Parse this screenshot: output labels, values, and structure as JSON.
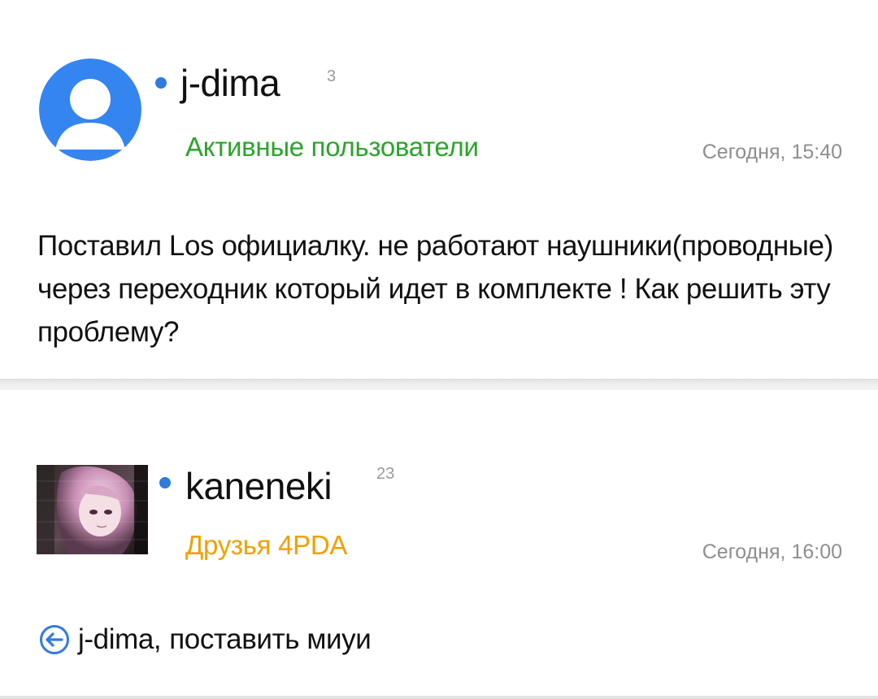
{
  "posts": [
    {
      "author": "j-dima",
      "reputation": "3",
      "group": "Активные пользователи",
      "group_color": "#2aa52a",
      "timestamp": "Сегодня, 15:40",
      "text": "Поставил Los официалку. не работают наушники(проводные) через переходник который идет в комплекте ! Как решить эту проблему?",
      "online": true,
      "avatar": "default-user-icon"
    },
    {
      "author": "kaneneki",
      "reputation": "23",
      "group": "Друзья 4PDA",
      "group_color": "#f0a000",
      "timestamp": "Сегодня, 16:00",
      "reply_to": "j-dima,",
      "text": "поставить миуи",
      "online": true,
      "avatar": "anime-girl-photo"
    }
  ],
  "colors": {
    "online_dot": "#2f7be0",
    "avatar_bg": "#3485f0",
    "reply_icon": "#2f7be0"
  }
}
